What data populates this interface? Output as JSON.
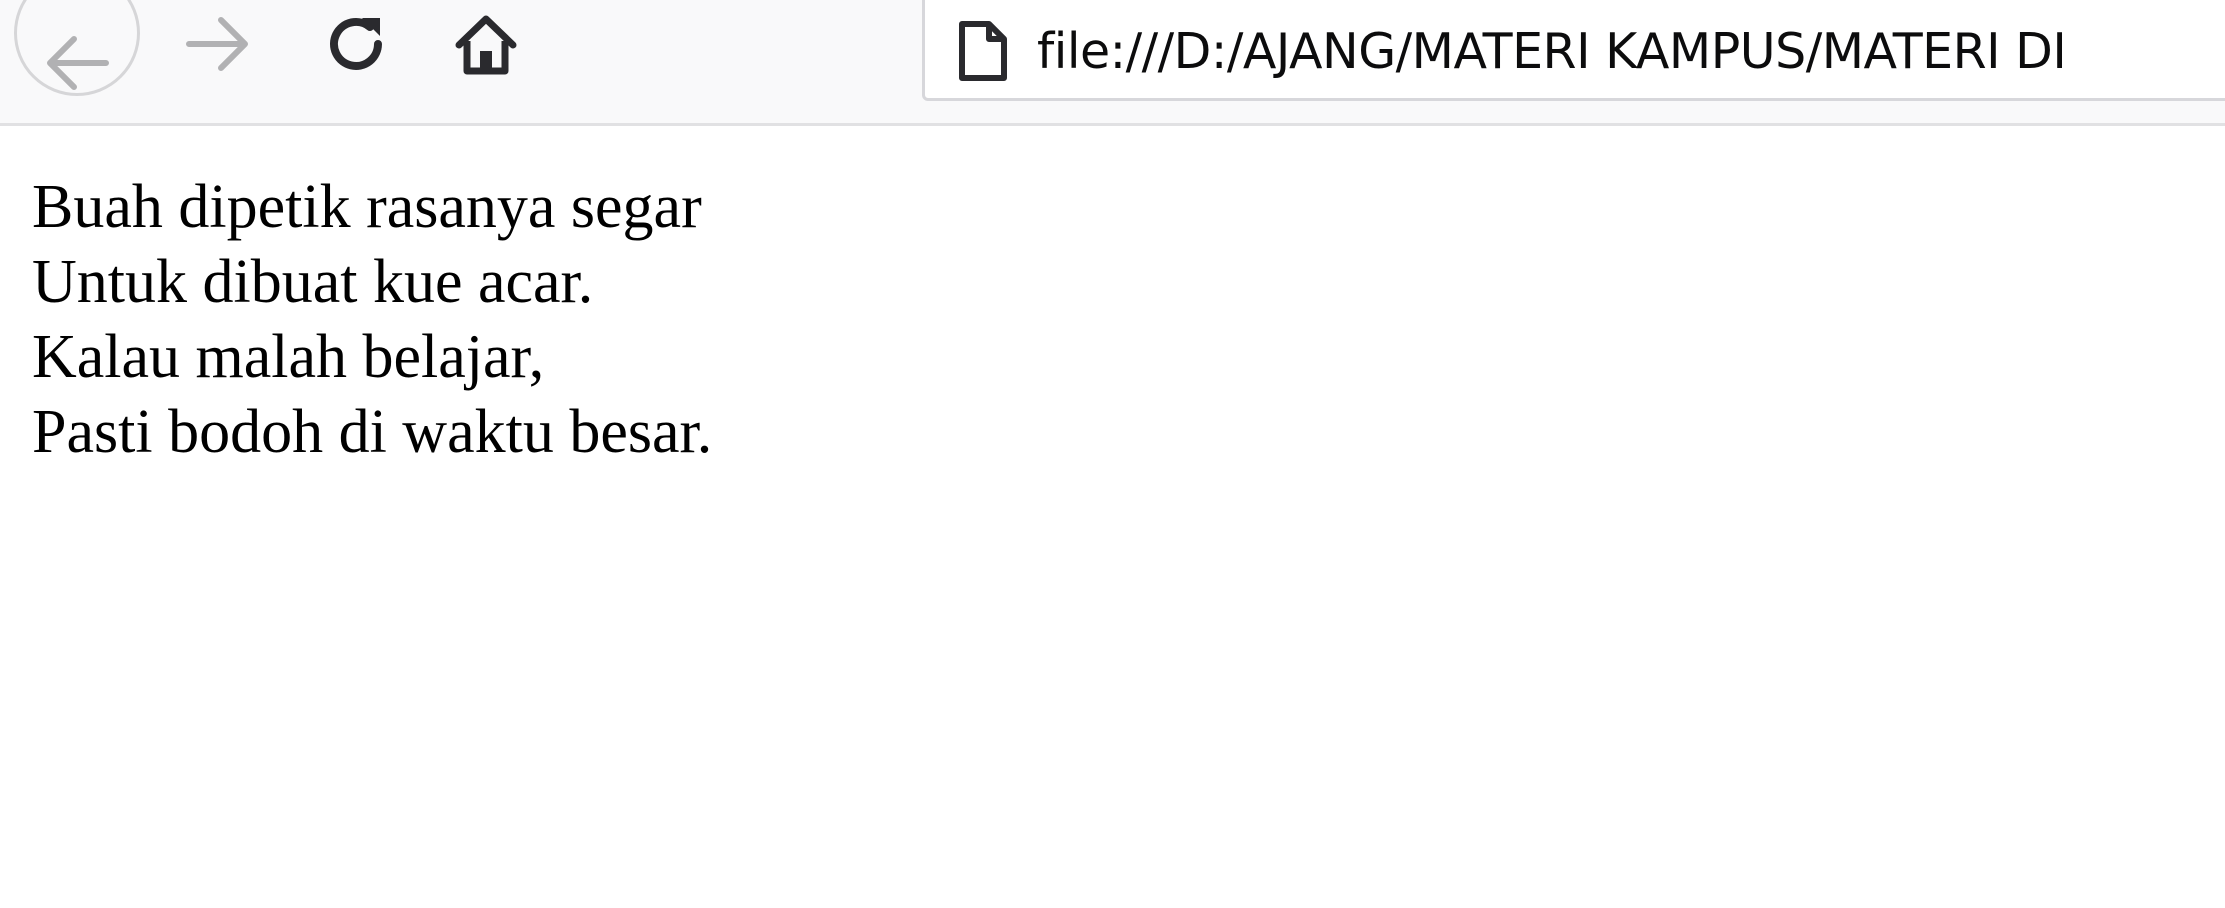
{
  "browser": {
    "url": "file:///D:/AJANG/MATERI KAMPUS/MATERI DI",
    "icons": {
      "back": "arrow-left-icon",
      "forward": "arrow-right-icon",
      "reload": "reload-icon",
      "home": "home-icon",
      "page": "page-icon"
    },
    "colors": {
      "toolbar_bg": "#f9f9fa",
      "icon_dark": "#2a2a2e",
      "icon_disabled": "#b1b1b3"
    }
  },
  "page": {
    "lines": [
      "Buah dipetik rasanya segar",
      "Untuk dibuat kue acar.",
      "Kalau malah belajar,",
      "Pasti bodoh di waktu besar."
    ]
  }
}
